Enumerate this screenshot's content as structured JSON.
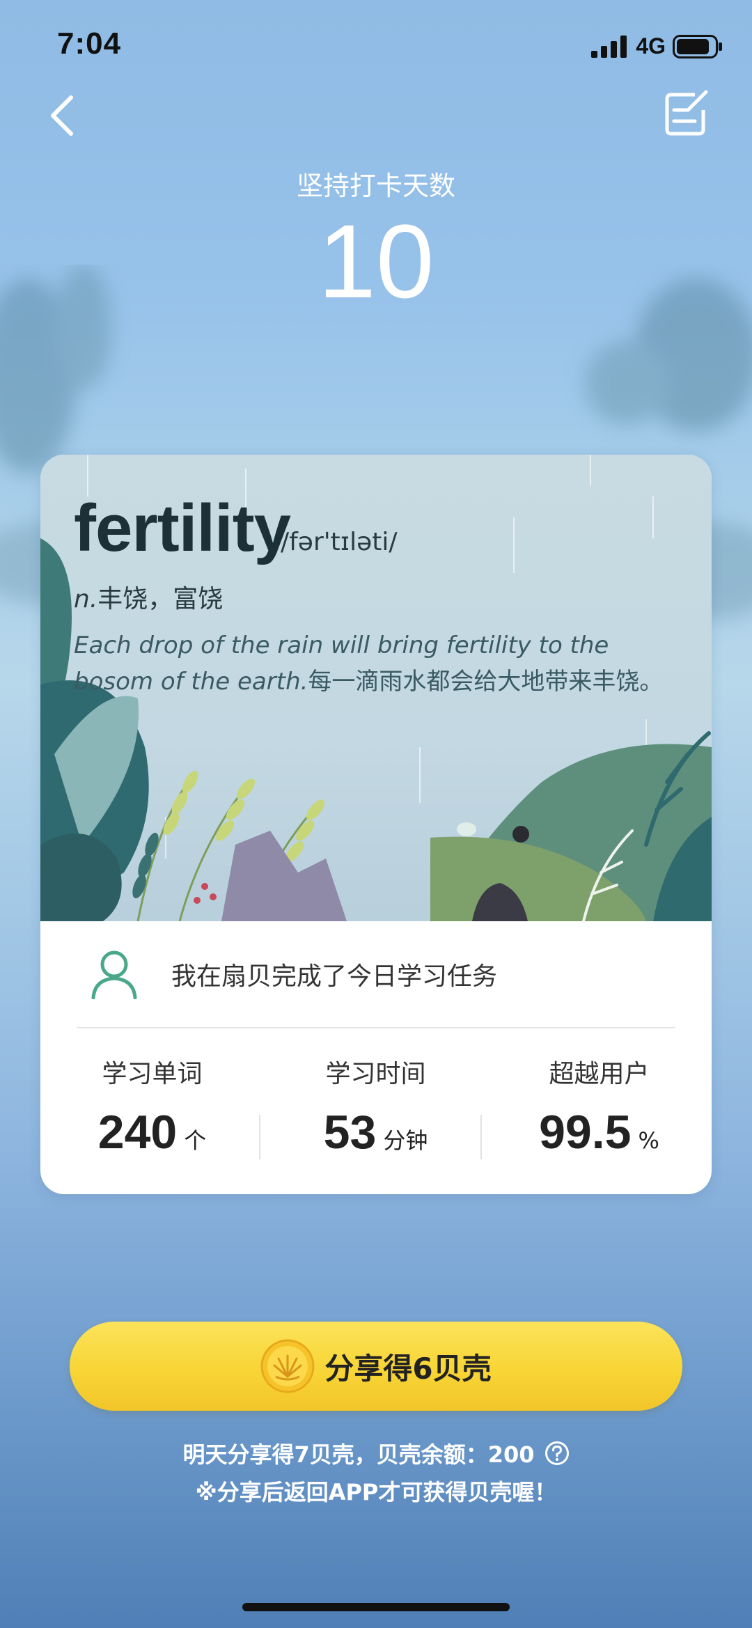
{
  "status_bar": {
    "time": "7:04",
    "network": "4G"
  },
  "header": {
    "streak_label": "坚持打卡天数",
    "streak_days": "10"
  },
  "word_card": {
    "word": "fertility",
    "phonetic": "/fər'tɪləti/",
    "part_of_speech": "n.",
    "meaning": "丰饶，富饶",
    "example_en": "Each drop of the rain will bring fertility to the bosom of the earth.",
    "example_zh": "每一滴雨水都会给大地带来丰饶。"
  },
  "user": {
    "completion_text": "我在扇贝完成了今日学习任务"
  },
  "stats": [
    {
      "label": "学习单词",
      "value": "240",
      "unit": "个"
    },
    {
      "label": "学习时间",
      "value": "53",
      "unit": "分钟"
    },
    {
      "label": "超越用户",
      "value": "99.5",
      "unit": "%"
    }
  ],
  "share": {
    "button_label": "分享得6贝壳"
  },
  "tips": {
    "tomorrow": "明天分享得7贝壳，贝壳余额：200",
    "note": "※分享后返回APP才可获得贝壳喔！"
  },
  "icons": {
    "back": "chevron-left-icon",
    "edit": "edit-note-icon",
    "avatar": "user-avatar-icon",
    "coin": "shell-coin-icon",
    "help": "question-circle-icon"
  },
  "colors": {
    "button_yellow": "#f8d536",
    "avatar_green": "#4aa88a",
    "word_dark": "#1c3038"
  }
}
